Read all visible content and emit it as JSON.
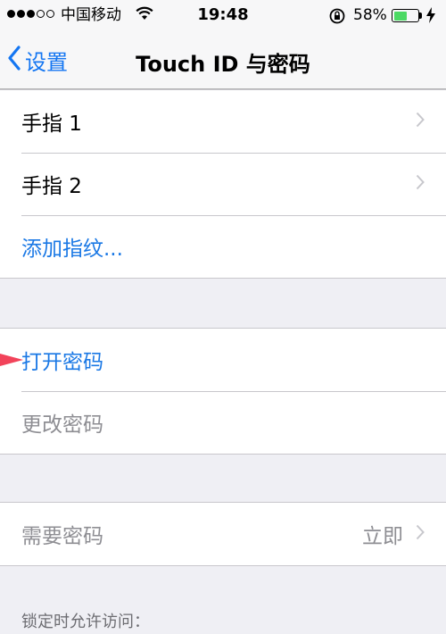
{
  "status_bar": {
    "carrier": "中国移动",
    "time": "19:48",
    "battery_percent": "58%",
    "battery_level": 0.58,
    "signal_bars_filled": 3,
    "signal_bars_total": 5
  },
  "nav": {
    "back_label": "设置",
    "title": "Touch ID 与密码"
  },
  "fingerprints": {
    "items": [
      {
        "label": "手指 1"
      },
      {
        "label": "手指 2"
      }
    ],
    "add_label": "添加指纹..."
  },
  "passcode": {
    "turn_on_label": "打开密码",
    "change_label": "更改密码"
  },
  "require": {
    "label": "需要密码",
    "value": "立即"
  },
  "footer": {
    "locked_access_header": "锁定时允许访问："
  },
  "colors": {
    "accent": "#1a78e5",
    "battery": "#4cd964",
    "pointer": "#f2435a"
  }
}
